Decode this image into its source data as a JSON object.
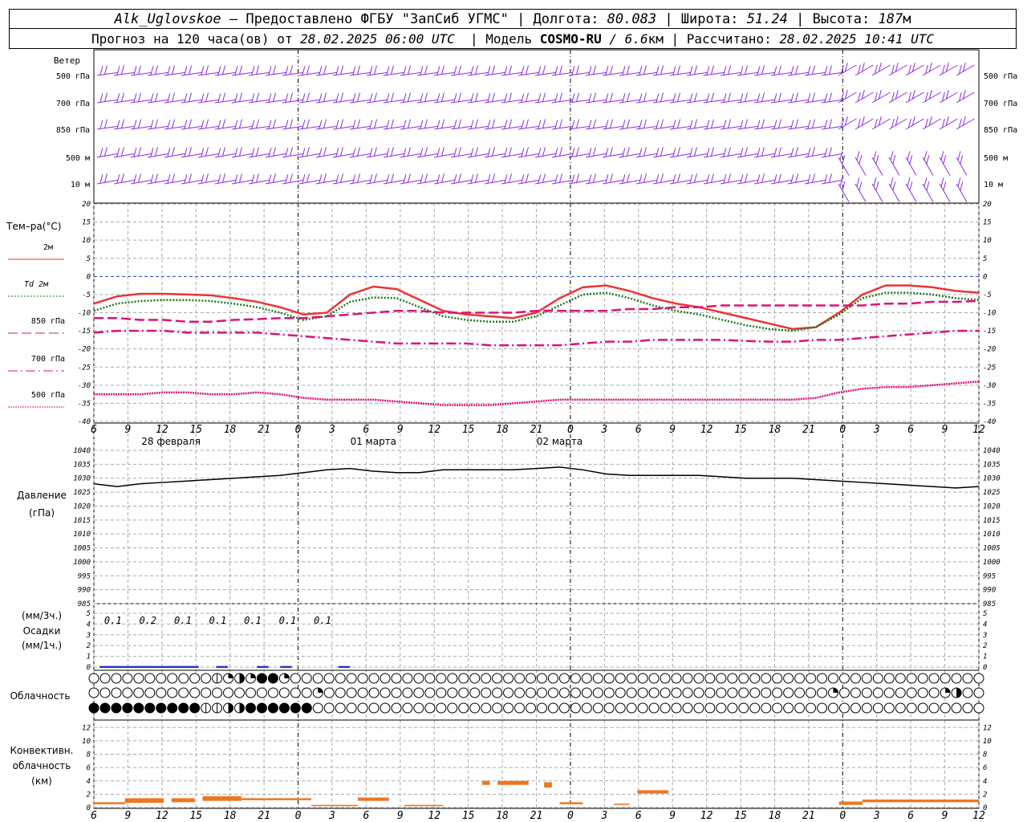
{
  "header": {
    "station": "Alk_Uglovskoe",
    "provider": " – Предоставлено ФГБУ \"ЗапСиб УГМС\" | Долгота: ",
    "lon": "80.083",
    "lat_label": " | Широта: ",
    "lat": "51.24",
    "alt_label": " | Высота: ",
    "alt": "187",
    "alt_unit": "м",
    "forecast_label": "Прогноз на 120 часа(ов) от ",
    "forecast_time": "28.02.2025 06:00 UTC",
    "model_label": "  | Модель ",
    "model": "COSMO-RU",
    "model_res": " / 6.6",
    "model_res_unit": "км",
    "calc_label": " | Рассчитано: ",
    "calc_time": "28.02.2025 10:41 UTC"
  },
  "time_axis": {
    "hour_labels": [
      "6",
      "9",
      "12",
      "15",
      "18",
      "21",
      "0",
      "3",
      "6",
      "9",
      "12",
      "15",
      "18",
      "21",
      "0",
      "3",
      "6",
      "9",
      "12",
      "15",
      "18",
      "21",
      "0",
      "3",
      "6",
      "9",
      "12"
    ],
    "day_labels": [
      "28 февраля",
      "01 марта",
      "02 марта"
    ],
    "day_label_hours": [
      12,
      36,
      60
    ]
  },
  "wind": {
    "title": "Ветер",
    "levels": [
      "500 гПа",
      "700 гПа",
      "850 гПа",
      "500 м",
      "10  м"
    ],
    "color": "#8a2be2"
  },
  "temperature": {
    "title": "Тем–ра(°С)",
    "legend": [
      {
        "label": "2м",
        "color": "#ee3333",
        "style": "solid"
      },
      {
        "label": "Td  2м",
        "color": "#1a7a1a",
        "style": "dotted"
      },
      {
        "label": "850 гПа",
        "color": "#dd1177",
        "style": "dashed"
      },
      {
        "label": "700 гПа",
        "color": "#dd1177",
        "style": "dashdot"
      },
      {
        "label": "500 гПа",
        "color": "#dd1177",
        "style": "dot-dense"
      }
    ],
    "ticks": [
      "20",
      "15",
      "10",
      "5",
      "0",
      "-5",
      "-10",
      "-15",
      "-20",
      "-25",
      "-30",
      "-35",
      "-40"
    ]
  },
  "pressure": {
    "title": "Давление",
    "unit": "(гПа)",
    "ticks": [
      "1040",
      "1035",
      "1030",
      "1025",
      "1020",
      "1015",
      "1010",
      "1005",
      "1000",
      "995",
      "990",
      "985"
    ]
  },
  "precip": {
    "title_a": "(мм/3ч.)",
    "title_b": "Осадки",
    "title_c": "(мм/1ч.)",
    "ticks": [
      "5",
      "4",
      "3",
      "2",
      "1",
      "0"
    ],
    "amounts": [
      "0.1",
      "0.2",
      "0.1",
      "0.1",
      "0.1",
      "0.1",
      "0.1"
    ],
    "color": "#2233cc"
  },
  "cloud": {
    "title": "Облачность",
    "rows": [
      [
        0,
        0,
        0,
        0,
        0,
        0,
        0,
        0,
        0,
        0,
        0,
        1,
        2,
        3,
        2,
        4,
        4,
        2,
        0,
        0,
        0,
        0,
        0,
        0,
        0,
        0,
        0,
        0,
        0,
        0,
        0,
        0,
        0,
        0,
        0,
        0,
        0,
        0,
        0,
        0,
        0,
        0,
        0,
        0,
        0,
        0,
        0,
        0,
        0,
        0,
        0,
        0,
        0,
        0,
        0,
        0,
        0,
        0,
        0,
        0,
        0,
        0,
        0,
        0,
        0,
        0,
        0,
        0,
        0,
        0,
        0,
        0,
        0,
        0,
        0,
        0,
        0,
        0,
        0,
        0,
        0,
        0,
        0,
        0,
        0,
        0,
        0,
        0,
        0,
        0,
        0,
        0,
        0,
        0,
        0,
        0,
        0,
        0,
        0,
        0,
        0,
        0,
        3,
        4,
        0,
        0,
        0,
        0,
        0,
        0,
        0,
        0,
        0,
        0,
        0,
        0,
        0,
        0,
        0,
        0,
        0,
        0,
        0,
        0,
        0,
        0,
        0,
        0,
        0,
        0,
        0,
        0,
        0,
        0,
        0,
        0,
        0,
        0,
        0,
        0,
        0,
        0,
        0,
        0,
        0,
        0,
        0,
        0,
        0,
        0,
        0,
        0,
        0,
        0,
        0,
        0,
        0,
        0,
        0,
        0,
        0,
        0,
        0,
        0,
        0,
        0,
        0,
        0,
        0,
        0,
        0,
        0,
        0,
        0,
        0,
        0,
        0,
        0,
        0,
        3,
        4
      ],
      [
        0,
        0,
        0,
        0,
        0,
        0,
        0,
        0,
        0,
        0,
        0,
        0,
        0,
        0,
        0,
        0,
        0,
        0,
        0,
        0,
        2,
        0,
        0,
        0,
        0,
        0,
        0,
        0,
        0,
        0,
        0,
        0,
        0,
        0,
        0,
        0,
        0,
        0,
        0,
        0,
        0,
        0,
        0,
        0,
        0,
        0,
        0,
        0,
        0,
        0,
        0,
        0,
        0,
        0,
        0,
        0,
        0,
        0,
        0,
        0,
        0,
        0,
        0,
        0,
        0,
        0,
        2,
        0,
        0,
        0,
        0,
        0,
        0,
        0,
        0,
        0,
        2,
        3,
        0,
        0,
        0,
        0,
        0,
        0,
        0,
        0,
        0,
        0,
        0,
        0,
        0,
        0,
        0,
        0,
        0,
        0,
        0,
        0,
        0,
        0,
        0,
        0,
        0,
        0,
        0,
        0,
        0,
        0,
        0,
        0,
        0,
        0,
        0,
        0,
        0,
        0,
        0,
        0,
        0,
        0,
        0,
        0,
        0,
        0,
        0,
        0,
        0,
        0,
        0,
        0,
        0,
        0,
        0,
        0,
        0,
        0,
        0,
        0,
        0,
        0,
        0,
        0,
        0,
        0,
        0,
        0,
        0,
        0,
        0,
        0,
        0,
        0,
        0,
        0,
        0,
        0,
        0,
        0,
        0,
        0,
        0,
        0,
        0,
        0,
        0,
        0,
        0,
        0,
        0,
        0,
        0,
        0,
        0,
        0,
        0,
        0,
        0,
        0,
        0,
        0,
        0,
        0
      ],
      [
        4,
        4,
        4,
        4,
        4,
        4,
        4,
        4,
        4,
        4,
        1,
        1,
        3,
        3,
        4,
        4,
        4,
        4,
        4,
        4,
        0,
        0,
        0,
        0,
        0,
        0,
        0,
        0,
        0,
        0,
        0,
        0,
        0,
        0,
        0,
        0,
        0,
        0,
        0,
        0,
        0,
        0,
        0,
        0,
        0,
        0,
        0,
        0,
        0,
        0,
        0,
        0,
        0,
        0,
        0,
        0,
        0,
        0,
        0,
        0,
        0,
        0,
        0,
        0,
        0,
        0,
        0,
        0,
        0,
        0,
        0,
        0,
        0,
        0,
        0,
        0,
        0,
        0,
        0,
        0,
        0,
        0,
        0,
        0,
        0,
        0,
        0,
        0,
        0,
        0,
        0,
        0,
        0,
        0,
        0,
        0,
        0,
        0,
        0,
        0,
        0,
        0,
        0,
        0,
        0,
        0,
        0,
        0,
        0,
        0,
        0,
        0,
        0,
        0,
        0,
        0,
        0,
        0,
        0,
        0,
        0,
        0,
        0,
        0,
        0,
        0,
        0,
        0,
        0,
        0,
        0,
        0,
        0,
        0,
        0,
        0,
        0,
        0,
        0,
        0,
        0,
        0,
        0,
        0,
        0,
        0,
        0,
        0,
        0,
        0,
        0,
        0,
        0,
        0,
        0,
        0,
        0,
        0,
        0,
        0,
        0,
        0,
        0,
        0,
        0,
        0,
        0,
        0,
        0,
        0,
        0,
        0,
        0,
        0,
        0,
        0,
        0,
        0,
        0,
        0,
        0,
        0
      ]
    ]
  },
  "convective": {
    "title_a": "Конвективн.",
    "title_b": "облачность",
    "title_c": "(км)",
    "ticks": [
      "12",
      "10",
      "8",
      "6",
      "4",
      "2",
      "0"
    ],
    "color": "#ee7722"
  },
  "chart_data": [
    {
      "type": "line",
      "title": "Тем–ра(°С)",
      "x_hours_from_start": [
        0,
        3,
        6,
        9,
        12,
        15,
        18,
        21,
        24,
        27,
        30,
        33,
        36,
        39,
        42,
        45,
        48,
        51,
        54,
        57,
        60,
        63,
        66,
        69,
        72,
        75,
        78,
        81,
        84,
        87,
        90,
        93,
        96,
        99,
        102,
        105,
        108,
        111,
        114
      ],
      "ylim": [
        -40,
        20
      ],
      "series": [
        {
          "name": "2м",
          "values": [
            -7.5,
            -5.5,
            -4.8,
            -4.8,
            -5.0,
            -5.2,
            -6.0,
            -7.0,
            -8.5,
            -10.5,
            -10.0,
            -5.0,
            -2.8,
            -3.5,
            -6.5,
            -9.5,
            -10.5,
            -11.0,
            -11.5,
            -10.0,
            -6.0,
            -3.0,
            -2.5,
            -4.0,
            -6.0,
            -7.5,
            -8.5,
            -10.0,
            -11.5,
            -13.0,
            -14.5,
            -14.0,
            -10.0,
            -5.0,
            -2.5,
            -2.5,
            -3.0,
            -4.0,
            -4.5
          ]
        },
        {
          "name": "Td  2м",
          "values": [
            -9.5,
            -7.5,
            -6.8,
            -6.5,
            -6.5,
            -6.8,
            -7.5,
            -8.5,
            -10.0,
            -12.0,
            -11.0,
            -7.0,
            -5.8,
            -6.0,
            -8.5,
            -11.0,
            -12.0,
            -12.5,
            -12.5,
            -11.0,
            -8.0,
            -5.0,
            -4.5,
            -6.0,
            -8.0,
            -9.5,
            -10.5,
            -12.0,
            -13.5,
            -14.5,
            -15.0,
            -14.0,
            -10.5,
            -6.0,
            -4.5,
            -4.5,
            -5.0,
            -6.0,
            -6.5
          ]
        },
        {
          "name": "850 гПа",
          "values": [
            -11.5,
            -11.5,
            -12.0,
            -12.0,
            -12.5,
            -12.5,
            -12.0,
            -11.8,
            -11.5,
            -11.5,
            -11.0,
            -10.5,
            -10.0,
            -9.5,
            -9.5,
            -10.0,
            -10.0,
            -10.0,
            -10.0,
            -9.5,
            -9.5,
            -9.5,
            -9.5,
            -9.0,
            -9.0,
            -8.5,
            -8.5,
            -8.0,
            -8.0,
            -8.0,
            -8.0,
            -8.0,
            -8.0,
            -8.0,
            -7.5,
            -7.5,
            -7.0,
            -7.0,
            -6.8
          ]
        },
        {
          "name": "700 гПа",
          "values": [
            -15.5,
            -15.0,
            -15.0,
            -15.0,
            -15.5,
            -15.5,
            -15.5,
            -15.5,
            -16.0,
            -16.5,
            -17.0,
            -17.5,
            -18.0,
            -18.5,
            -18.5,
            -18.5,
            -18.5,
            -19.0,
            -19.0,
            -19.0,
            -19.0,
            -18.5,
            -18.0,
            -18.0,
            -17.5,
            -17.5,
            -17.5,
            -17.5,
            -17.8,
            -18.0,
            -18.0,
            -17.5,
            -17.5,
            -17.0,
            -16.5,
            -16.0,
            -15.5,
            -15.0,
            -15.0
          ]
        },
        {
          "name": "500 гПа",
          "values": [
            -32.5,
            -32.5,
            -32.5,
            -32.0,
            -32.0,
            -32.5,
            -32.5,
            -32.0,
            -32.5,
            -33.5,
            -34.0,
            -34.0,
            -34.0,
            -34.5,
            -35.0,
            -35.5,
            -35.5,
            -35.5,
            -35.0,
            -34.5,
            -34.0,
            -34.0,
            -34.0,
            -34.0,
            -34.0,
            -34.0,
            -34.0,
            -34.0,
            -34.0,
            -34.0,
            -34.0,
            -33.5,
            -32.0,
            -31.0,
            -30.5,
            -30.5,
            -30.0,
            -29.5,
            -29.0
          ]
        }
      ]
    },
    {
      "type": "line",
      "title": "Давление",
      "ylabel": "(гПа)",
      "x_hours_from_start": [
        0,
        3,
        6,
        9,
        12,
        15,
        18,
        21,
        24,
        27,
        30,
        33,
        36,
        39,
        42,
        45,
        48,
        51,
        54,
        57,
        60,
        63,
        66,
        69,
        72,
        75,
        78,
        81,
        84,
        87,
        90,
        93,
        96,
        99,
        102,
        105,
        108,
        111,
        114
      ],
      "ylim": [
        985,
        1040
      ],
      "series": [
        {
          "name": "",
          "values": [
            1028,
            1027,
            1028,
            1028.5,
            1029,
            1029.5,
            1030,
            1030.5,
            1031,
            1032,
            1033,
            1033.5,
            1032.5,
            1032,
            1032,
            1033,
            1033,
            1033,
            1033,
            1033.5,
            1034,
            1033,
            1031.5,
            1031,
            1031,
            1031,
            1031,
            1030.5,
            1030,
            1030,
            1030,
            1029.5,
            1029,
            1028.5,
            1028,
            1027.5,
            1027,
            1026.5,
            1027
          ]
        }
      ]
    },
    {
      "type": "bar",
      "title": "Осадки",
      "ylabel": "(мм/3ч.)",
      "ylim": [
        0,
        5
      ],
      "labeled_amounts_mm_3h": [
        0.1,
        0.2,
        0.1,
        0.1,
        0.1,
        0.1,
        0.1
      ],
      "labeled_hours_from_start": [
        1.5,
        4.5,
        7.5,
        10.5,
        13.5,
        16.5,
        19.5
      ]
    },
    {
      "type": "bar",
      "title": "Конвективн. облачность",
      "ylabel": "(км)",
      "ylim": [
        0,
        13
      ],
      "segments": [
        {
          "h0": 0,
          "h1": 4,
          "base": 0.5,
          "top": 0.8
        },
        {
          "h0": 4,
          "h1": 9,
          "base": 0.7,
          "top": 1.4
        },
        {
          "h0": 10,
          "h1": 13,
          "base": 0.8,
          "top": 1.4
        },
        {
          "h0": 14,
          "h1": 19,
          "base": 1.0,
          "top": 1.7
        },
        {
          "h0": 19,
          "h1": 28,
          "base": 1.1,
          "top": 1.4
        },
        {
          "h0": 28,
          "h1": 34,
          "base": 0.2,
          "top": 0.4
        },
        {
          "h0": 34,
          "h1": 38,
          "base": 1.0,
          "top": 1.5
        },
        {
          "h0": 40,
          "h1": 45,
          "base": 0.2,
          "top": 0.4
        },
        {
          "h0": 50,
          "h1": 51,
          "base": 3.4,
          "top": 4.0
        },
        {
          "h0": 52,
          "h1": 56,
          "base": 3.4,
          "top": 4.0
        },
        {
          "h0": 58,
          "h1": 59,
          "base": 3.0,
          "top": 3.8
        },
        {
          "h0": 60,
          "h1": 63,
          "base": 0.5,
          "top": 0.8
        },
        {
          "h0": 67,
          "h1": 69,
          "base": 0.4,
          "top": 0.6
        },
        {
          "h0": 70,
          "h1": 74,
          "base": 2.1,
          "top": 2.6
        },
        {
          "h0": 96,
          "h1": 99,
          "base": 0.4,
          "top": 0.9
        },
        {
          "h0": 99,
          "h1": 114,
          "base": 0.8,
          "top": 1.2
        }
      ]
    }
  ]
}
